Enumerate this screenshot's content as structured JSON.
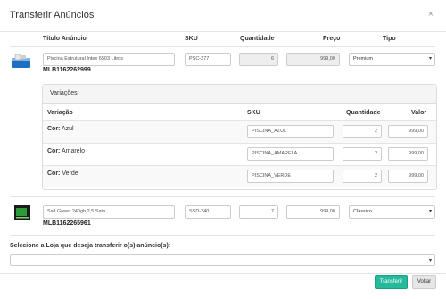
{
  "modal": {
    "title": "Transferir Anúncios",
    "close": "×"
  },
  "table": {
    "headers": {
      "title": "Título Anúncio",
      "sku": "SKU",
      "quantity": "Quantidade",
      "price": "Preço",
      "type": "Tipo"
    }
  },
  "listings": [
    {
      "title": "Piscina Estrutural Intex 6503 Litros",
      "sku": "PSC-277",
      "quantity": "6",
      "price": "999,00",
      "type": "Premium",
      "id": "MLB1162262999",
      "thumb": "pool-thumbnail"
    },
    {
      "title": "Ssd Green 240gb 2,5 Sata",
      "sku": "SSD-240",
      "quantity": "7",
      "price": "999,00",
      "type": "Clássico",
      "id": "MLB1162265961",
      "thumb": "ssd-thumbnail"
    }
  ],
  "variations": {
    "title": "Variações",
    "headers": {
      "variation": "Variação",
      "sku": "SKU",
      "quantity": "Quantidade",
      "value": "Valor"
    },
    "label_prefix": "Cor:",
    "rows": [
      {
        "color": "Azul",
        "sku": "PISCINA_AZUL",
        "quantity": "2",
        "value": "999,00"
      },
      {
        "color": "Amarelo",
        "sku": "PISCINA_AMARELA",
        "quantity": "2",
        "value": "999,00"
      },
      {
        "color": "Verde",
        "sku": "PISCINA_VERDE",
        "quantity": "2",
        "value": "999,00"
      }
    ]
  },
  "store": {
    "label": "Selecione a Loja que deseja transferir o(s) anúncio(s):",
    "value": ""
  },
  "buttons": {
    "transfer": "Transferir",
    "back": "Voltar"
  },
  "colors": {
    "primary": "#26b99a",
    "pool": "#1e6fc0",
    "ssd": "#2e9b3a"
  }
}
